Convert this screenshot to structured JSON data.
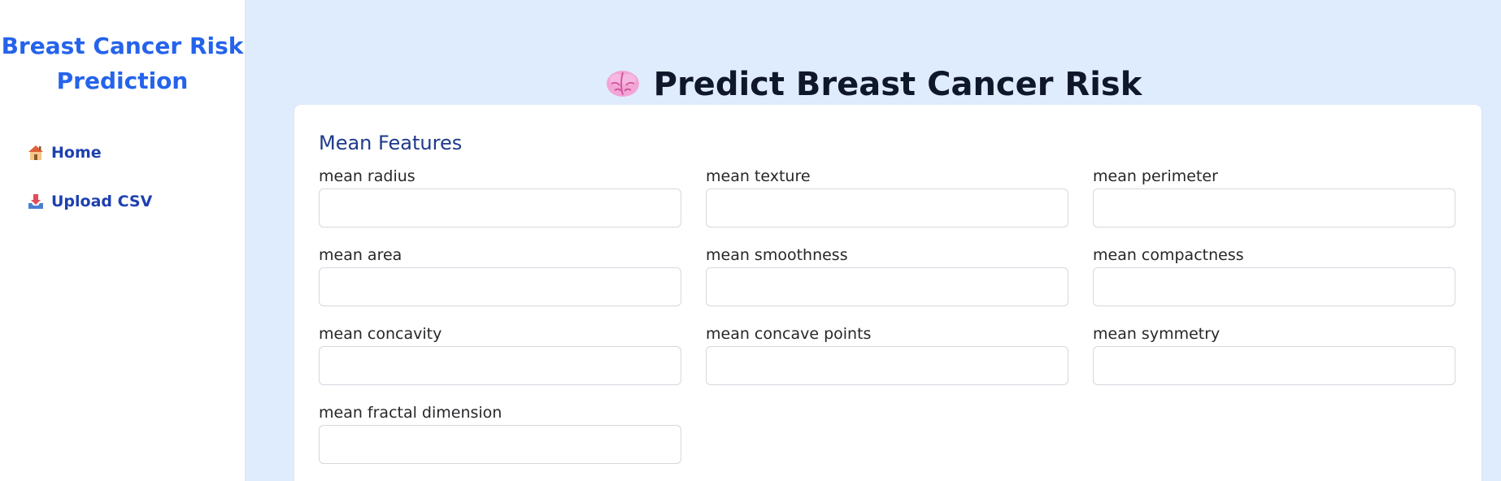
{
  "sidebar": {
    "brand": "Breast Cancer Risk Prediction",
    "items": [
      {
        "label": "Home",
        "icon": "house-icon"
      },
      {
        "label": "Upload CSV",
        "icon": "inbox-tray-icon"
      }
    ]
  },
  "main": {
    "title": "Predict Breast Cancer Risk",
    "title_icon": "brain-icon",
    "section_title": "Mean Features",
    "fields": [
      {
        "label": "mean radius",
        "value": ""
      },
      {
        "label": "mean texture",
        "value": ""
      },
      {
        "label": "mean perimeter",
        "value": ""
      },
      {
        "label": "mean area",
        "value": ""
      },
      {
        "label": "mean smoothness",
        "value": ""
      },
      {
        "label": "mean compactness",
        "value": ""
      },
      {
        "label": "mean concavity",
        "value": ""
      },
      {
        "label": "mean concave points",
        "value": ""
      },
      {
        "label": "mean symmetry",
        "value": ""
      },
      {
        "label": "mean fractal dimension",
        "value": ""
      }
    ]
  },
  "colors": {
    "brand": "#2563eb",
    "nav_text": "#1e40af",
    "main_background": "#dfecfd",
    "section_title": "#1e3a8a",
    "page_title": "#0f172a"
  }
}
